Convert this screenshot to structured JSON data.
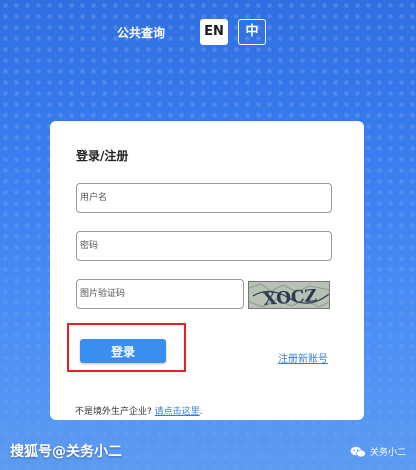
{
  "header": {
    "public_query": "公共查询",
    "lang_en": "EN",
    "lang_zh": "中"
  },
  "login": {
    "title": "登录/注册",
    "username_placeholder": "用户名",
    "password_placeholder": "密码",
    "captcha_placeholder": "图片验证码",
    "captcha_text": "XOCZ",
    "login_button": "登录",
    "register_link": "注册新账号",
    "foreign_question": "不是境外生产企业?",
    "foreign_link": "请点击这里",
    "foreign_period": "."
  },
  "watermark": {
    "left": "搜狐号@关务小二",
    "right": "关务小二",
    "icon": "wechat-icon"
  },
  "colors": {
    "primary": "#3a8ef0",
    "link": "#2f7fd6",
    "highlight": "#e02424",
    "background": "#3a7ef0"
  }
}
